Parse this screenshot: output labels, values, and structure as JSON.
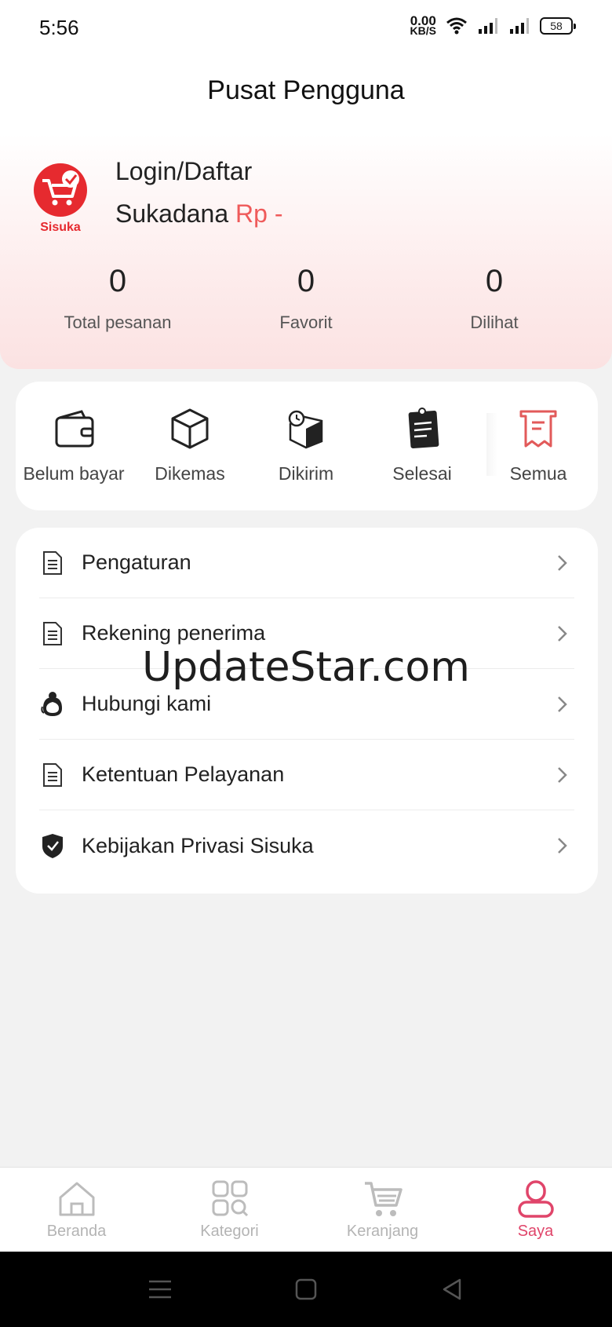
{
  "status_bar": {
    "time": "5:56",
    "net_speed_value": "0.00",
    "net_speed_unit": "KB/S",
    "battery": "58"
  },
  "header": {
    "title": "Pusat Pengguna"
  },
  "profile": {
    "logo_text": "Sisuka",
    "login_label": "Login/Daftar",
    "balance_label": "Sukadana",
    "balance_value": "Rp -",
    "stats": [
      {
        "value": "0",
        "label": "Total pesanan"
      },
      {
        "value": "0",
        "label": "Favorit"
      },
      {
        "value": "0",
        "label": "Dilihat"
      }
    ]
  },
  "orders": {
    "items": [
      {
        "label": "Belum bayar",
        "icon": "wallet-icon"
      },
      {
        "label": "Dikemas",
        "icon": "box-icon"
      },
      {
        "label": "Dikirim",
        "icon": "shipping-box-clock-icon"
      },
      {
        "label": "Selesai",
        "icon": "clipboard-done-icon"
      },
      {
        "label": "Semua",
        "icon": "receipt-icon"
      }
    ]
  },
  "menu": {
    "items": [
      {
        "label": "Pengaturan",
        "icon": "document-icon"
      },
      {
        "label": "Rekening penerima",
        "icon": "document-icon"
      },
      {
        "label": "Hubungi kami",
        "icon": "customer-service-icon"
      },
      {
        "label": "Ketentuan Pelayanan",
        "icon": "document-icon"
      },
      {
        "label": "Kebijakan Privasi Sisuka",
        "icon": "shield-check-icon"
      }
    ]
  },
  "watermark": "UpdateStar.com",
  "bottom_nav": {
    "items": [
      {
        "label": "Beranda",
        "icon": "home-icon"
      },
      {
        "label": "Kategori",
        "icon": "category-icon"
      },
      {
        "label": "Keranjang",
        "icon": "cart-icon"
      },
      {
        "label": "Saya",
        "icon": "user-icon",
        "active": true
      }
    ]
  },
  "colors": {
    "accent": "#e0456a",
    "balance": "#ef5a5a",
    "logo_red": "#e62a2f"
  }
}
